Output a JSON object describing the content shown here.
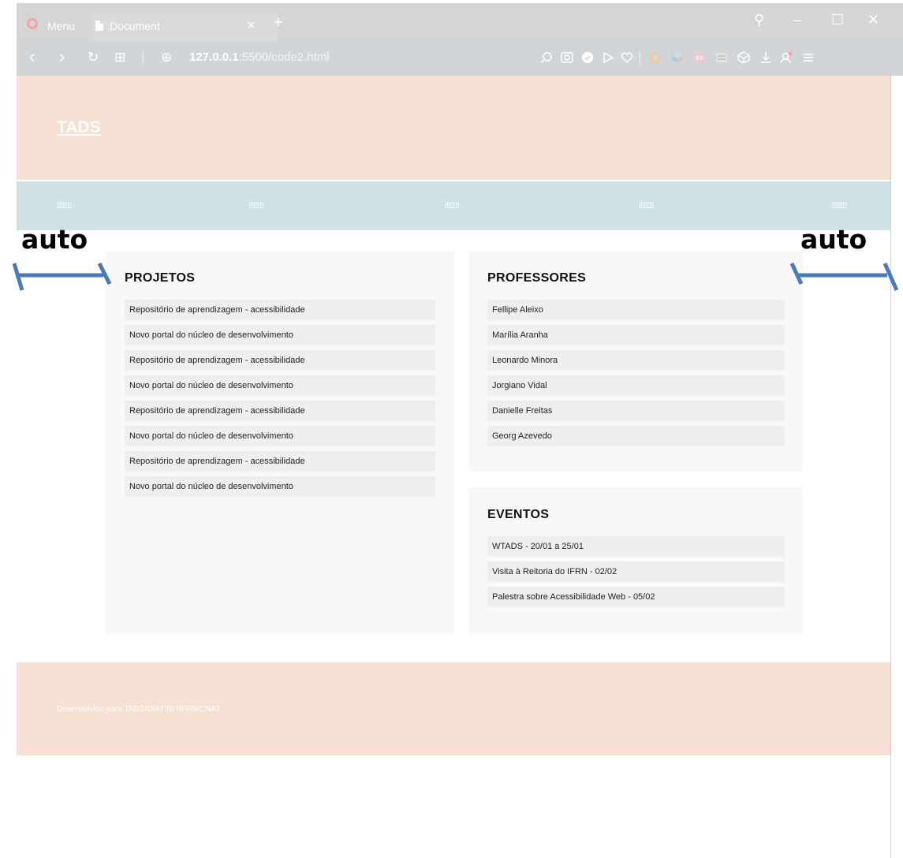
{
  "browser": {
    "menu_label": "Menu",
    "tab_title": "Document",
    "tab_close": "×",
    "new_tab": "+",
    "url_host": "127.0.0.1",
    "url_path": ":5500/code2.html",
    "nav_icons": {
      "back": "‹",
      "forward": "›",
      "reload": "↻",
      "speed_dial": "⊞",
      "globe": "⊕"
    },
    "window_controls": {
      "search": "⚲",
      "minimize": "–",
      "maximize": "☐",
      "close": "✕"
    },
    "toolbar_icons": [
      "search-icon",
      "camera-icon",
      "vpn-shield-icon",
      "play-icon",
      "heart-icon",
      "color-wheel-icon",
      "cube-icon",
      "es-extension-icon",
      "image-icon",
      "box-icon",
      "download-icon",
      "profile-icon",
      "menu-icon"
    ]
  },
  "site": {
    "logo": "TADS",
    "nav": [
      "item",
      "item",
      "item",
      "item",
      "item"
    ],
    "projetos": {
      "title": "PROJETOS",
      "items": [
        "Repositório de aprendizagem - acessibilidade",
        "Novo portal do núcleo de desenvolvimento",
        "Repositório de aprendizagem - acessibilidade",
        "Novo portal do núcleo de desenvolvimento",
        "Repositório de aprendizagem - acessibilidade",
        "Novo portal do núcleo de desenvolvimento",
        "Repositório de aprendizagem - acessibilidade",
        "Novo portal do núcleo de desenvolvimento"
      ]
    },
    "professores": {
      "title": "PROFESSORES",
      "items": [
        "Fellipe Aleixo",
        "Marília Aranha",
        "Leonardo Minora",
        "Jorgiano Vidal",
        "Danielle Freitas",
        "Georg Azevedo"
      ]
    },
    "eventos": {
      "title": "EVENTOS",
      "items": [
        "WTADS - 20/01 a 25/01",
        "Visita à Reitoria do IFRN - 02/02",
        "Palestra sobre Acessibilidade Web - 05/02"
      ]
    },
    "footer": "Desenvolvido para TADS/DIATINF/IFRN/CNAT"
  },
  "annotations": {
    "left": "auto",
    "right": "auto"
  },
  "colors": {
    "header_bg": "#f6e0d4",
    "nav_bg": "#cee1e5",
    "panel_bg": "#f8f8f8",
    "item_bg": "#efefef",
    "arrow": "#4a7ab8"
  }
}
